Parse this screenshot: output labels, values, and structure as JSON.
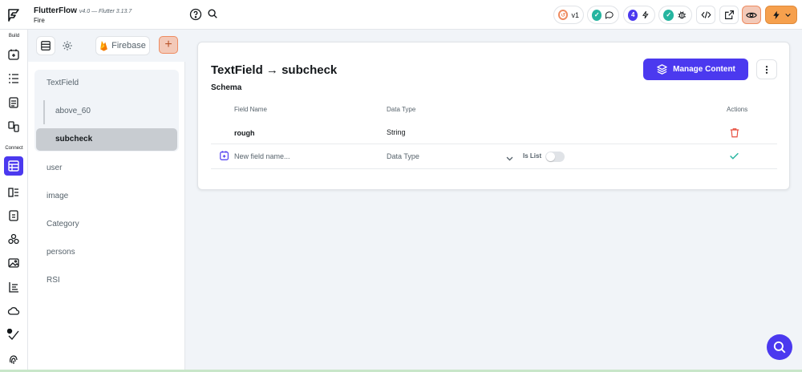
{
  "app": {
    "name": "FlutterFlow",
    "version": "v4.0 — Flutter 3.13.7",
    "project": "Fire"
  },
  "topbar": {
    "version_label": "v1",
    "badge_count": "4"
  },
  "rail": {
    "build_label": "Build",
    "connect_label": "Connect"
  },
  "panel": {
    "firebase_label": "Firebase",
    "collections": {
      "textfield": "TextField",
      "above_60": "above_60",
      "subcheck": "subcheck",
      "user": "user",
      "image": "image",
      "category": "Category",
      "persons": "persons",
      "rsi": "RSI"
    }
  },
  "main": {
    "title": "TextField → subcheck",
    "subtitle": "Schema",
    "manage_button": "Manage Content",
    "columns": {
      "field_name": "Field Name",
      "data_type": "Data Type",
      "actions": "Actions"
    },
    "rows": [
      {
        "field_name": "rough",
        "data_type": "String"
      }
    ],
    "new_field": {
      "placeholder": "New field name...",
      "data_type_placeholder": "Data Type",
      "is_list_label": "Is List"
    }
  },
  "colors": {
    "accent": "#4b39ef",
    "secondary": "#ee8b60",
    "success": "#26b5a0",
    "error": "#e74c3c"
  }
}
